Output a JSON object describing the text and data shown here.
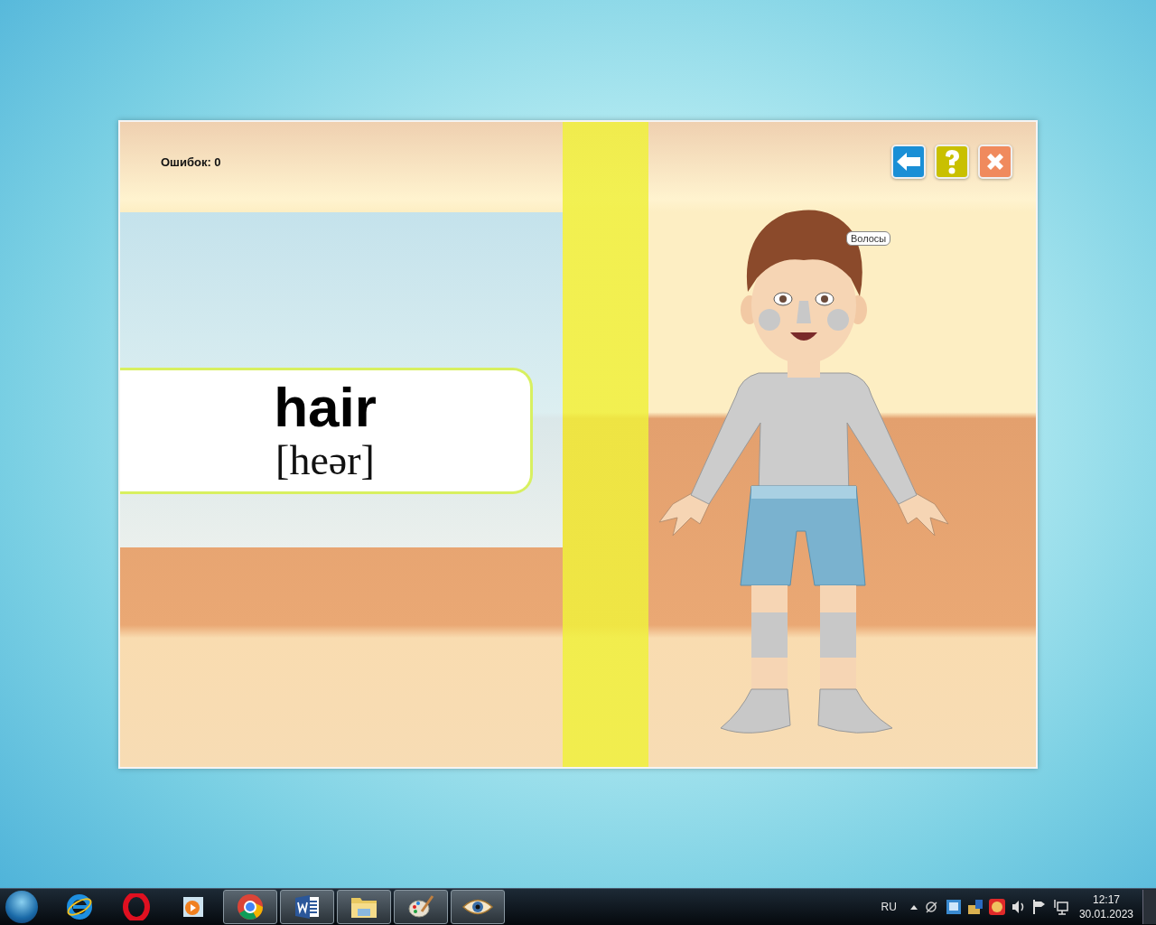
{
  "game": {
    "errors_label": "Ошибок: 0",
    "buttons": [
      {
        "kind": "back"
      },
      {
        "kind": "help"
      },
      {
        "kind": "close"
      }
    ],
    "word": "hair",
    "transcription": "[heər]",
    "tooltip": "Волосы"
  },
  "taskbar": {
    "apps": [
      {
        "kind": "ie",
        "running": false
      },
      {
        "kind": "opera",
        "running": false
      },
      {
        "kind": "media",
        "running": false
      },
      {
        "kind": "chrome",
        "running": true
      },
      {
        "kind": "word",
        "running": true
      },
      {
        "kind": "folder",
        "running": true
      },
      {
        "kind": "paint",
        "running": true
      },
      {
        "kind": "eye",
        "running": true
      }
    ],
    "language": "RU",
    "time": "12:17",
    "date": "30.01.2023"
  }
}
